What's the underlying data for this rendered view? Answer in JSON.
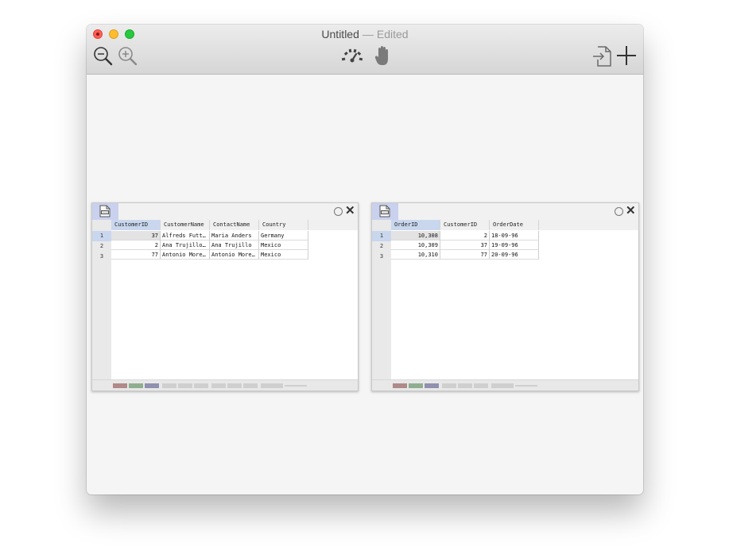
{
  "window": {
    "title": "Untitled",
    "separator": "—",
    "status": "Edited"
  },
  "toolbar": {
    "icons": [
      "zoom-out-icon",
      "zoom-in-icon",
      "speedometer-icon",
      "hand-icon",
      "import-icon",
      "add-icon"
    ]
  },
  "tables": [
    {
      "columns": [
        "CustomerID",
        "CustomerName",
        "ContactName",
        "Country"
      ],
      "row_numbers": [
        "1",
        "2",
        "3"
      ],
      "rows": [
        [
          "37",
          "Alfreds Futter…",
          "Maria Anders",
          "Germany"
        ],
        [
          "2",
          "Ana Trujillo E…",
          "Ana Trujillo",
          "Mexico"
        ],
        [
          "77",
          "Antonio Moreno…",
          "Antonio Moreno",
          "Mexico"
        ]
      ]
    },
    {
      "columns": [
        "OrderID",
        "CustomerID",
        "OrderDate"
      ],
      "row_numbers": [
        "1",
        "2",
        "3"
      ],
      "rows": [
        [
          "10,308",
          "2",
          "18-09-96"
        ],
        [
          "10,309",
          "37",
          "19-09-96"
        ],
        [
          "10,310",
          "77",
          "20-09-96"
        ]
      ]
    }
  ],
  "colors": {
    "selection": "#c9d7ee",
    "csv_tab": "#c9d1ee",
    "footer_swatches": [
      "#b08a8a",
      "#8fae8f",
      "#9090b0"
    ]
  }
}
